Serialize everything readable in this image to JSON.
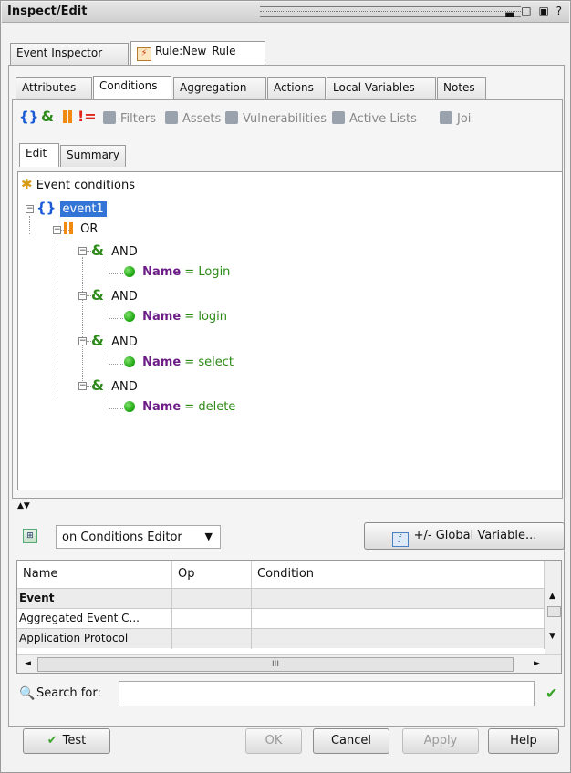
{
  "window": {
    "title": "Inspect/Edit",
    "controls": [
      "▃",
      "□",
      "▣",
      "?"
    ]
  },
  "top_tabs": [
    {
      "label": "Event Inspector",
      "active": false
    },
    {
      "label": "Rule:New_Rule",
      "active": true,
      "icon": "lightning-icon"
    }
  ],
  "sub_tabs": [
    {
      "label": "Attributes",
      "active": false
    },
    {
      "label": "Conditions",
      "active": true
    },
    {
      "label": "Aggregation",
      "active": false
    },
    {
      "label": "Actions",
      "active": false
    },
    {
      "label": "Local Variables",
      "active": false
    },
    {
      "label": "Notes",
      "active": false
    }
  ],
  "toolbar": {
    "symbols": [
      "{}",
      "&",
      "||",
      "!="
    ],
    "items": [
      "Filters",
      "Assets",
      "Vulnerabilities",
      "Active Lists",
      "Joi"
    ]
  },
  "edit_tabs": [
    {
      "label": "Edit",
      "active": true
    },
    {
      "label": "Summary",
      "active": false
    }
  ],
  "tree": {
    "root": "Event conditions",
    "event": "event1",
    "or_label": "OR",
    "groups": [
      {
        "op": "AND",
        "field": "Name",
        "eq": "=",
        "value": "Login"
      },
      {
        "op": "AND",
        "field": "Name",
        "eq": "=",
        "value": "login"
      },
      {
        "op": "AND",
        "field": "Name",
        "eq": "=",
        "value": "select"
      },
      {
        "op": "AND",
        "field": "Name",
        "eq": "=",
        "value": "delete"
      }
    ]
  },
  "editor": {
    "dropdown_value": "on Conditions Editor",
    "global_button": "+/- Global Variable..."
  },
  "grid": {
    "columns": [
      "Name",
      "Op",
      "Condition"
    ],
    "rows": [
      {
        "name": "Event",
        "op": "",
        "condition": "",
        "header": true
      },
      {
        "name": "Aggregated Event C...",
        "op": "",
        "condition": "",
        "header": false
      },
      {
        "name": "Application Protocol",
        "op": "",
        "condition": "",
        "header": false
      }
    ],
    "scroll_grip": "III"
  },
  "search": {
    "label": "Search for:",
    "value": ""
  },
  "buttons": {
    "test": "Test",
    "ok": "OK",
    "cancel": "Cancel",
    "apply": "Apply",
    "help": "Help"
  },
  "colors": {
    "brace": "#1a5ad6",
    "and": "#2f8a1c",
    "or": "#f08a10",
    "field": "#6c1d86",
    "value": "#2b8a14",
    "selection": "#3375d6"
  }
}
